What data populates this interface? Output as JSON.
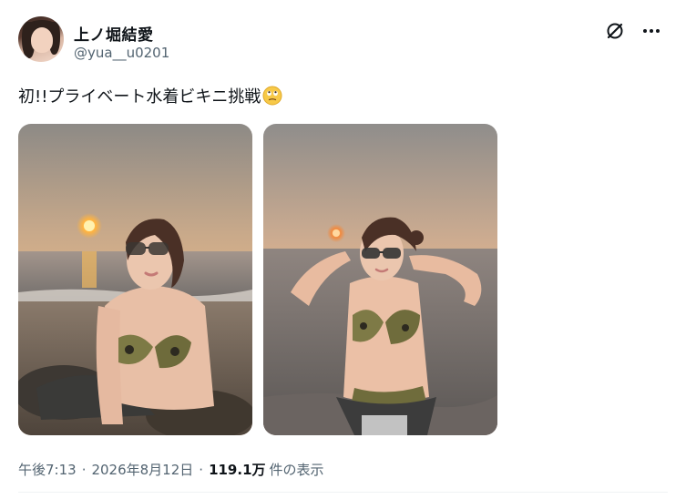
{
  "post": {
    "display_name": "上ノ堀結愛",
    "handle": "@yua__u0201",
    "text": "初!!プライベート水着ビキニ挑戦",
    "emoji": "face-with-rolling-eyes-emoji",
    "images": [
      {
        "name": "beach-photo-1",
        "alt": ""
      },
      {
        "name": "beach-photo-2",
        "alt": ""
      }
    ],
    "time": "午後7:13",
    "separator": "·",
    "date": "2026年8月12日",
    "views_count": "119.1万",
    "views_label": "件の表示"
  },
  "icons": {
    "grok": "grok-icon",
    "more": "more-options-icon"
  },
  "colors": {
    "text_primary": "#0f1419",
    "text_secondary": "#536471",
    "divider": "#eff3f4"
  }
}
